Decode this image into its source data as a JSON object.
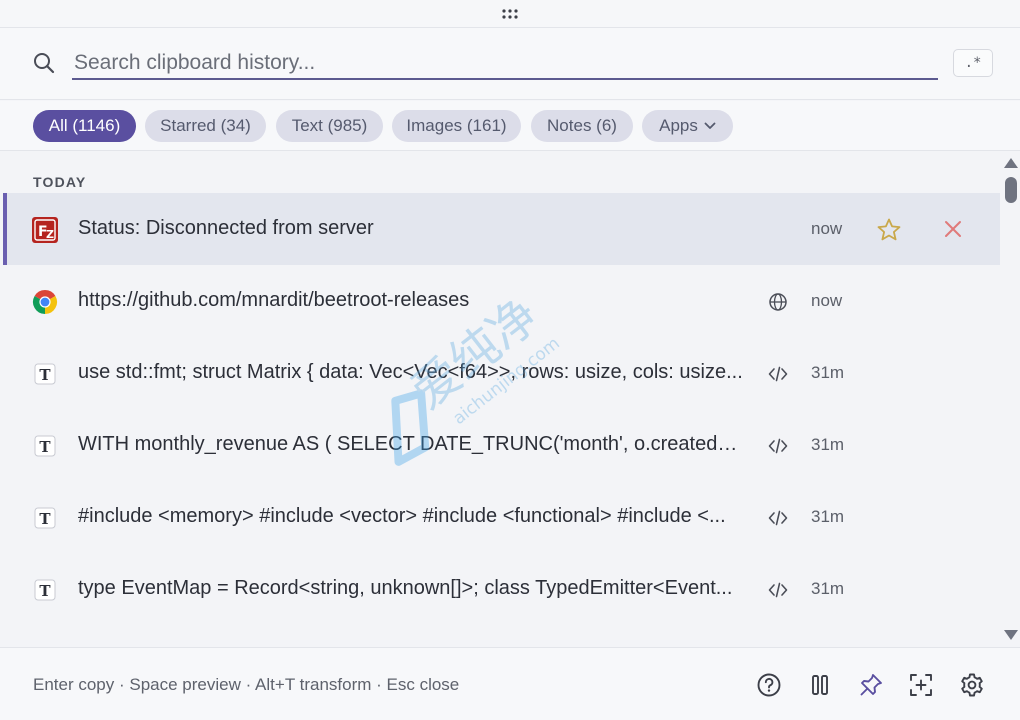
{
  "search": {
    "placeholder": "Search clipboard history...",
    "value": "",
    "regex_label": ".*"
  },
  "filters": [
    {
      "label": "All (1146)",
      "active": true
    },
    {
      "label": "Starred (34)",
      "active": false
    },
    {
      "label": "Text (985)",
      "active": false
    },
    {
      "label": "Images (161)",
      "active": false
    },
    {
      "label": "Notes (6)",
      "active": false
    },
    {
      "label": "Apps",
      "active": false
    }
  ],
  "list": {
    "section_label": "TODAY",
    "items": [
      {
        "app_icon": "filezilla-icon",
        "content": "Status: Disconnected from server",
        "type_icon": "",
        "time": "now",
        "selected": true
      },
      {
        "app_icon": "chrome-icon",
        "content": "https://github.com/mnardit/beetroot-releases",
        "type_icon": "globe-icon",
        "time": "now",
        "selected": false
      },
      {
        "app_icon": "text-icon",
        "content": "use std::fmt; struct Matrix { data: Vec<Vec<f64>>, rows: usize, cols: usize...",
        "type_icon": "code-icon",
        "time": "31m",
        "selected": false
      },
      {
        "app_icon": "text-icon",
        "content": "WITH monthly_revenue AS ( SELECT DATE_TRUNC('month', o.created_at)...",
        "type_icon": "code-icon",
        "time": "31m",
        "selected": false
      },
      {
        "app_icon": "text-icon",
        "content": "#include <memory> #include <vector> #include <functional> #include <...",
        "type_icon": "code-icon",
        "time": "31m",
        "selected": false
      },
      {
        "app_icon": "text-icon",
        "content": "type EventMap = Record<string, unknown[]>; class TypedEmitter<Event...",
        "type_icon": "code-icon",
        "time": "31m",
        "selected": false
      }
    ]
  },
  "footer": {
    "hint": "Enter copy · Space preview · Alt+T transform · Esc close",
    "buttons": [
      "help-icon",
      "pause-icon",
      "pin-icon",
      "capture-icon",
      "settings-icon"
    ]
  },
  "colors": {
    "accent": "#5a4fa0",
    "chip_bg": "#dcdde9",
    "selected_row": "#e3e6ee",
    "star": "#c9a84a",
    "delete": "#e07a7a"
  },
  "watermark": {
    "text": "爱纯净",
    "sub": "aichunjing.com"
  }
}
